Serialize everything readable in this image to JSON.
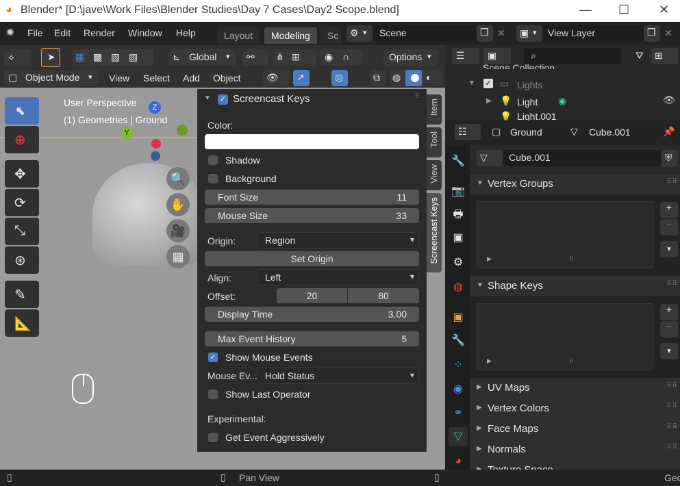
{
  "window": {
    "title": "Blender* [D:\\jave\\Work Files\\Blender Studies\\Day 7 Cases\\Day2 Scope.blend]"
  },
  "menu": [
    "File",
    "Edit",
    "Render",
    "Window",
    "Help"
  ],
  "workspace_tabs": [
    "Layout",
    "Modeling",
    "Sc"
  ],
  "scene": {
    "label": "Scene"
  },
  "view_layer": {
    "label": "View Layer"
  },
  "header": {
    "transform": "Global",
    "options": "Options",
    "mode": "Object Mode",
    "menus": [
      "View",
      "Select",
      "Add",
      "Object"
    ]
  },
  "viewport": {
    "perspective": "User Perspective",
    "context": "(1) Geometries | Ground",
    "axes": {
      "z": "Z",
      "y": "Y"
    }
  },
  "npanel": {
    "title": "Screencast Keys",
    "color_label": "Color:",
    "shadow": "Shadow",
    "background": "Background",
    "font_size": {
      "label": "Font Size",
      "value": "11"
    },
    "mouse_size": {
      "label": "Mouse Size",
      "value": "33"
    },
    "origin": {
      "label": "Origin:",
      "value": "Region"
    },
    "set_origin": "Set Origin",
    "align": {
      "label": "Align:",
      "value": "Left"
    },
    "offset": {
      "label": "Offset:",
      "x": "20",
      "y": "80"
    },
    "display_time": {
      "label": "Display Time",
      "value": "3.00"
    },
    "max_event_history": {
      "label": "Max Event History",
      "value": "5"
    },
    "show_mouse_events": "Show Mouse Events",
    "mouse_event": {
      "label": "Mouse Ev...",
      "value": "Hold Status"
    },
    "show_last_operator": "Show Last Operator",
    "experimental": "Experimental:",
    "get_event_aggressively": "Get Event Aggressively"
  },
  "side_tabs": [
    "Item",
    "Tool",
    "View",
    "Screencast Keys"
  ],
  "outliner": {
    "scene_collection": "Scene Collection",
    "items": [
      "Lights",
      "Light",
      "Light.001"
    ]
  },
  "properties": {
    "breadcrumb_object": "Ground",
    "breadcrumb_data": "Cube.001",
    "mesh_name": "Cube.001",
    "sections": [
      "Vertex Groups",
      "Shape Keys",
      "UV Maps",
      "Vertex Colors",
      "Face Maps",
      "Normals",
      "Texture Space"
    ]
  },
  "statusbar": {
    "center": "Pan View",
    "right": "Geo"
  },
  "colors": {
    "accent": "#4a7cc6",
    "active_tab": "#474747",
    "viewport_bg": "#9b9b9b"
  }
}
